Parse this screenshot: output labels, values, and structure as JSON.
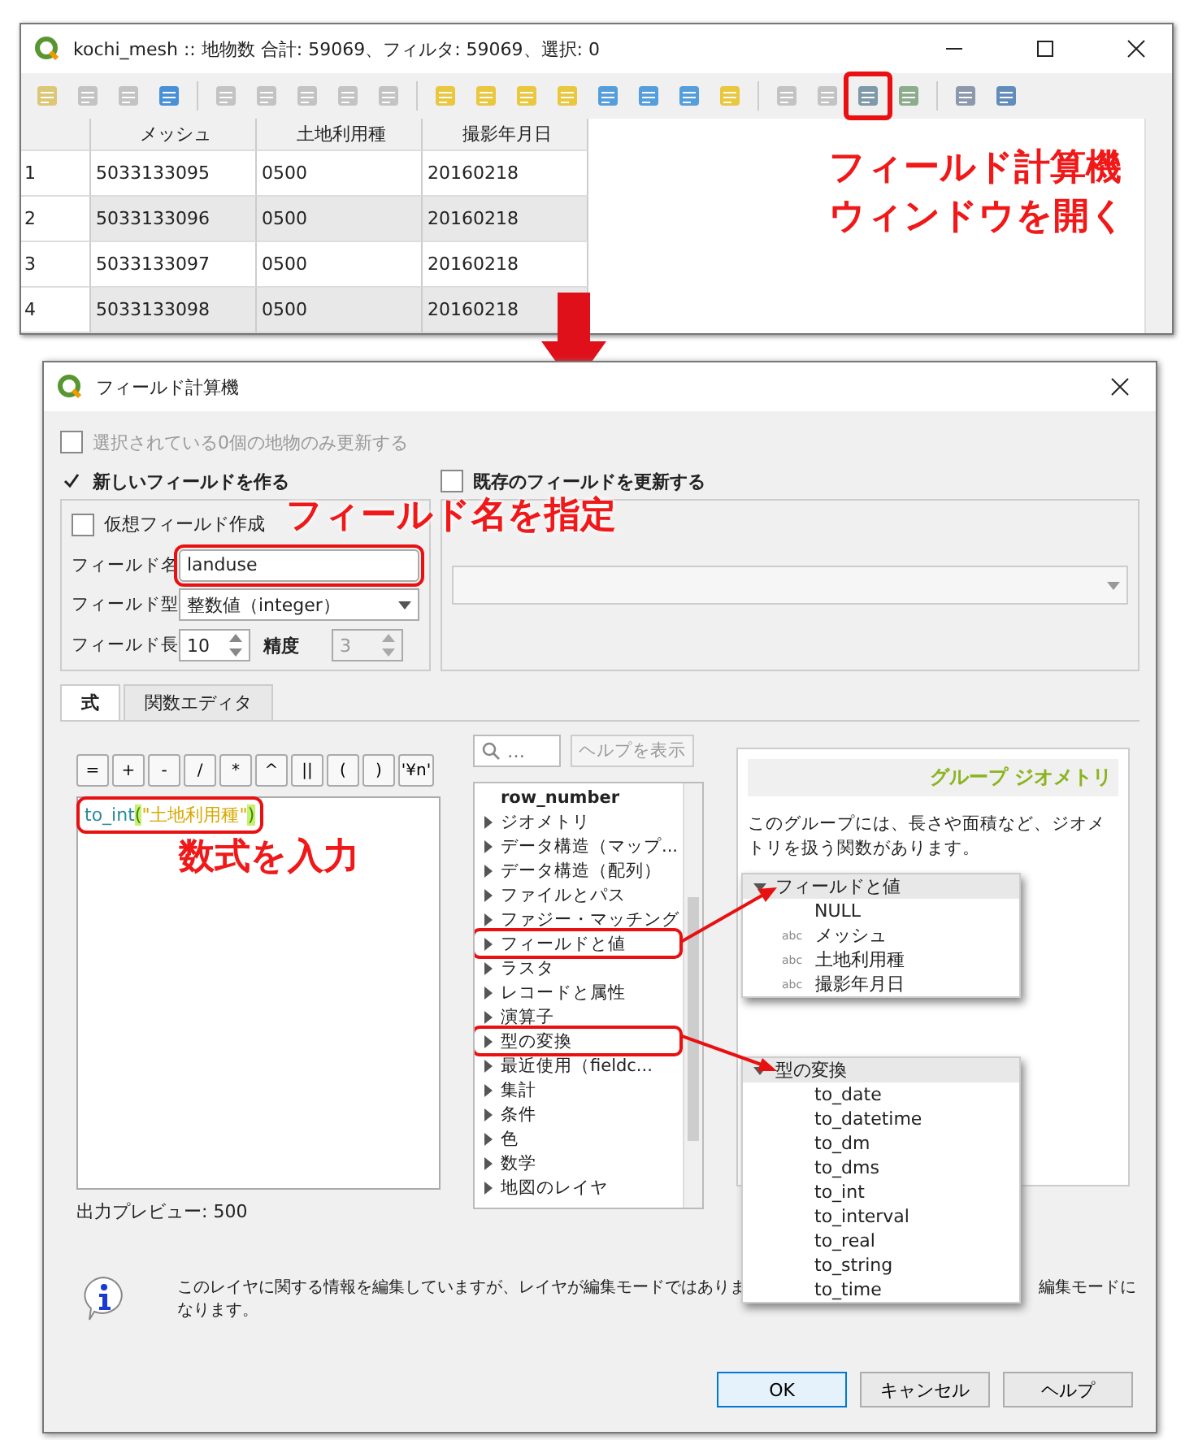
{
  "main_window": {
    "title": "kochi_mesh :: 地物数 合計: 59069、フィルタ: 59069、選択: 0",
    "callout": [
      "フィールド計算機",
      "ウィンドウを開く"
    ],
    "table": {
      "columns": [
        "メッシュ",
        "土地利用種",
        "撮影年月日"
      ],
      "rows": [
        {
          "number": "1",
          "cells": [
            "5033133095",
            "0500",
            "20160218"
          ]
        },
        {
          "number": "2",
          "cells": [
            "5033133096",
            "0500",
            "20160218"
          ]
        },
        {
          "number": "3",
          "cells": [
            "5033133097",
            "0500",
            "20160218"
          ]
        },
        {
          "number": "4",
          "cells": [
            "5033133098",
            "0500",
            "20160218"
          ]
        }
      ]
    }
  },
  "dialog": {
    "title": "フィールド計算機",
    "selected_only": {
      "label": "選択されている0個の地物のみ更新する",
      "checked": false,
      "disabled": true
    },
    "create_new": {
      "label": "新しいフィールドを作る",
      "checked": true
    },
    "update_existing": {
      "label": "既存のフィールドを更新する",
      "checked": false
    },
    "virtual_field": {
      "label": "仮想フィールド作成",
      "checked": false
    },
    "field_name": {
      "label": "フィールド名",
      "value": "landuse",
      "highlighted": true,
      "callout": "フィールド名を指定"
    },
    "field_type": {
      "label": "フィールド型",
      "value": "整数値（integer）"
    },
    "field_length": {
      "label": "フィールド長",
      "value": "10"
    },
    "precision": {
      "label": "精度",
      "value": "3",
      "disabled": true
    },
    "tabs": [
      {
        "label": "式",
        "selected": true
      },
      {
        "label": "関数エディタ",
        "selected": false
      }
    ],
    "operators": [
      "=",
      "+",
      "-",
      "/",
      "*",
      "^",
      "||",
      "(",
      ")",
      "'¥n'"
    ],
    "expression": {
      "highlighted": true,
      "callout": "数式を入力",
      "tokens": [
        {
          "text": "to_int",
          "kind": "function"
        },
        {
          "text": "(",
          "kind": "bracket"
        },
        {
          "text": "\"土地利用種\"",
          "kind": "string"
        },
        {
          "text": ")",
          "kind": "bracket"
        }
      ]
    },
    "preview": "出力プレビュー: 500",
    "search": {
      "placeholder": "…"
    },
    "show_help": {
      "label": "ヘルプを表示",
      "disabled": true
    },
    "tree": [
      {
        "label": "row_number",
        "kind": "item",
        "highlighted": false
      },
      {
        "label": "ジオメトリ",
        "kind": "group",
        "highlighted": false
      },
      {
        "label": "データ構造（マップ...",
        "kind": "group",
        "highlighted": false
      },
      {
        "label": "データ構造（配列）",
        "kind": "group",
        "highlighted": false
      },
      {
        "label": "ファイルとパス",
        "kind": "group",
        "highlighted": false
      },
      {
        "label": "ファジー・マッチング",
        "kind": "group",
        "highlighted": false
      },
      {
        "label": "フィールドと値",
        "kind": "group",
        "highlighted": true
      },
      {
        "label": "ラスタ",
        "kind": "group",
        "highlighted": false
      },
      {
        "label": "レコードと属性",
        "kind": "group",
        "highlighted": false
      },
      {
        "label": "演算子",
        "kind": "group",
        "highlighted": false
      },
      {
        "label": "型の変換",
        "kind": "group",
        "highlighted": true
      },
      {
        "label": "最近使用（fieldc...",
        "kind": "group",
        "highlighted": false
      },
      {
        "label": "集計",
        "kind": "group",
        "highlighted": false
      },
      {
        "label": "条件",
        "kind": "group",
        "highlighted": false
      },
      {
        "label": "色",
        "kind": "group",
        "highlighted": false
      },
      {
        "label": "数学",
        "kind": "group",
        "highlighted": false
      },
      {
        "label": "地図のレイヤ",
        "kind": "group",
        "highlighted": false
      }
    ],
    "help_panel": {
      "title": "グループ ジオメトリ",
      "text": "このグループには、長さや面積など、ジオメトリを扱う関数があります。"
    },
    "message": {
      "line_1_start": "このレイヤに関する情報を編集していますが、レイヤが編集モードではありま",
      "line_1_end": "編集モードに",
      "line_2": "なります。"
    },
    "buttons": [
      {
        "label": "OK",
        "default": true
      },
      {
        "label": "キャンセル",
        "default": false
      },
      {
        "label": "ヘルプ",
        "default": false
      }
    ]
  },
  "popups": [
    {
      "title": "フィールドと値",
      "expanded": true,
      "items": [
        {
          "label": "NULL",
          "kind": "value"
        },
        {
          "label": "メッシュ",
          "kind": "field",
          "tag": "abc"
        },
        {
          "label": "土地利用種",
          "kind": "field",
          "tag": "abc"
        },
        {
          "label": "撮影年月日",
          "kind": "field",
          "tag": "abc"
        }
      ]
    },
    {
      "title": "型の変換",
      "expanded": true,
      "items": [
        {
          "label": "to_date",
          "kind": "function"
        },
        {
          "label": "to_datetime",
          "kind": "function"
        },
        {
          "label": "to_dm",
          "kind": "function"
        },
        {
          "label": "to_dms",
          "kind": "function"
        },
        {
          "label": "to_int",
          "kind": "function"
        },
        {
          "label": "to_interval",
          "kind": "function"
        },
        {
          "label": "to_real",
          "kind": "function"
        },
        {
          "label": "to_string",
          "kind": "function"
        },
        {
          "label": "to_time",
          "kind": "function"
        }
      ]
    }
  ]
}
